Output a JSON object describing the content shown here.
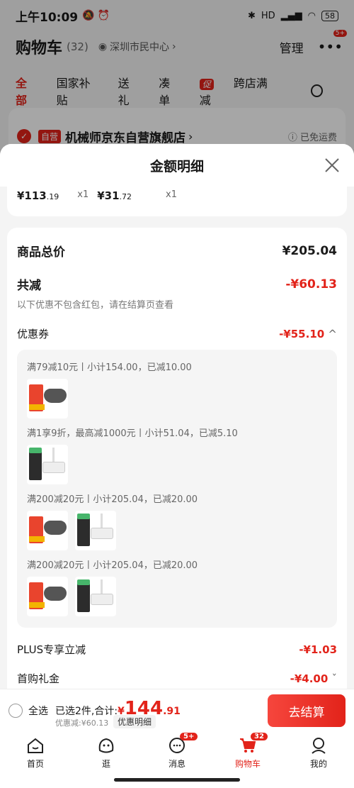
{
  "status_bar": {
    "time": "上午10:09",
    "network": "HD",
    "battery": "58"
  },
  "header": {
    "title": "购物车",
    "count": "(32)",
    "location": "深圳市民中心",
    "manage": "管理",
    "more_badge": "5+"
  },
  "filters": [
    {
      "label": "全部"
    },
    {
      "label": "国家补贴"
    },
    {
      "label": "送礼"
    },
    {
      "label": "凑单"
    },
    {
      "label": "跨店满减",
      "tag": "促"
    }
  ],
  "store": {
    "badge": "自营",
    "name": "机械师京东自营旗舰店",
    "shipping": "已免运费"
  },
  "sheet": {
    "title": "金额明细",
    "items": [
      {
        "price_main": "¥113",
        "price_dec": ".19",
        "qty": "x1"
      },
      {
        "price_main": "¥31",
        "price_dec": ".72",
        "qty": "x1"
      }
    ],
    "total_label": "商品总价",
    "total_value": "¥205.04",
    "discount_label": "共减",
    "discount_value": "-¥60.13",
    "discount_note": "以下优惠不包含红包，请在结算页查看",
    "coupon_label": "优惠券",
    "coupon_value": "-¥55.10",
    "coupon_groups": [
      {
        "text": "满79减10元丨小计154.00，已减10.00",
        "thumbs": [
          "controller"
        ]
      },
      {
        "text": "满1享9折，最高减1000元丨小计51.04，已减5.10",
        "thumbs": [
          "hub"
        ]
      },
      {
        "text": "满200减20元丨小计205.04，已减20.00",
        "thumbs": [
          "controller",
          "hub"
        ]
      },
      {
        "text": "满200减20元丨小计205.04，已减20.00",
        "thumbs": [
          "controller",
          "hub"
        ]
      }
    ],
    "plus_label": "PLUS专享立减",
    "plus_value": "-¥1.03",
    "first_label": "首购礼金",
    "first_value": "-¥4.00"
  },
  "bottom_bar": {
    "select_all": "全选",
    "selected_text": "已选2件,合计:",
    "currency": "¥",
    "amount_int": "144",
    "amount_dec": ".91",
    "saved": "优惠减:¥60.13",
    "detail_btn": "优惠明细",
    "checkout": "去结算"
  },
  "tabbar": [
    {
      "label": "首页",
      "icon": "home-icon"
    },
    {
      "label": "逛",
      "icon": "browse-icon"
    },
    {
      "label": "消息",
      "icon": "message-icon",
      "badge": "5+"
    },
    {
      "label": "购物车",
      "icon": "cart-icon",
      "badge": "32",
      "active": true
    },
    {
      "label": "我的",
      "icon": "profile-icon"
    }
  ],
  "colors": {
    "accent": "#e2231a",
    "overlay": "#9a9a9a"
  }
}
